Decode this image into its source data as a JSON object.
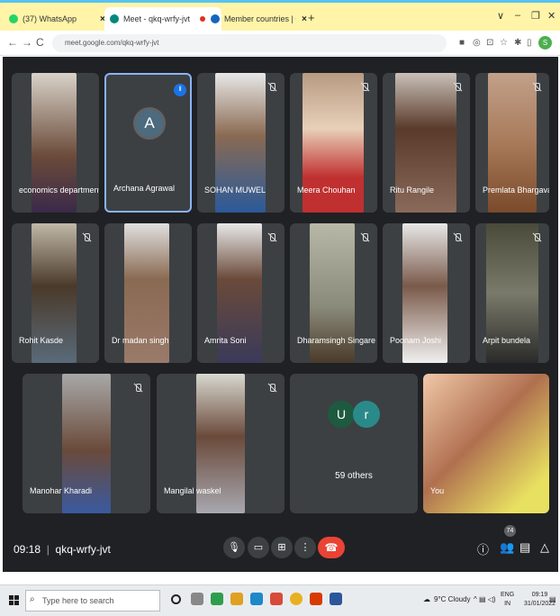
{
  "browser": {
    "tabs": [
      {
        "label": "(37) WhatsApp",
        "icon": "whatsapp-icon",
        "color": "#25d366",
        "active": false
      },
      {
        "label": "Meet - qkq-wrfy-jvt",
        "icon": "meet-icon",
        "color": "#00897b",
        "active": true
      },
      {
        "label": "Member countries | Commonwe",
        "icon": "globe-icon",
        "color": "#1565c0",
        "active": false
      }
    ],
    "url": "meet.google.com/qkq-wrfy-jvt",
    "profile_initial": "S"
  },
  "meet": {
    "participants_row1": [
      "economics department",
      "Archana Agrawal",
      "SOHAN MUWEL",
      "Meera Chouhan",
      "Ritu Rangile",
      "Premlata Bhargava"
    ],
    "participants_row2": [
      "Rohit Kasde",
      "Dr madan singh",
      "Amrita Soni",
      "Dharamsingh Singare",
      "Poonam Joshi",
      "Arpit bundela"
    ],
    "participants_row3": [
      "Manohar Kharadi",
      "Mangilal waskel"
    ],
    "archana_initial": "A",
    "others_initials": [
      "U",
      "r"
    ],
    "others_label": "59 others",
    "you_label": "You",
    "time": "09:18",
    "meeting_code": "qkq-wrfy-jvt",
    "participant_count": "74"
  },
  "taskbar": {
    "search_placeholder": "Type here to search",
    "weather": "9°C  Cloudy",
    "lang_top": "ENG",
    "lang_bottom": "IN",
    "time": "09:19",
    "date": "31/01/2022"
  }
}
